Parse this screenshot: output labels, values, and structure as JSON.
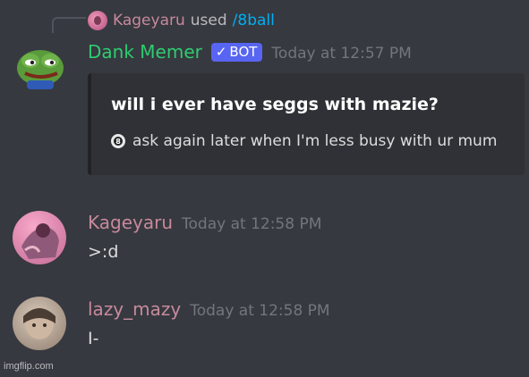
{
  "reply": {
    "username": "Kageyaru",
    "used_text": "used",
    "command": "/8ball"
  },
  "messages": [
    {
      "author": "Dank Memer",
      "badge": "BOT",
      "timestamp": "Today at 12:57 PM",
      "embed": {
        "title": "will i ever have seggs with mazie?",
        "description": "ask again later when I'm less busy with ur mum"
      }
    },
    {
      "author": "Kageyaru",
      "timestamp": "Today at 12:58 PM",
      "content": ">:d"
    },
    {
      "author": "lazy_mazy",
      "timestamp": "Today at 12:58 PM",
      "content": "I-"
    }
  ],
  "watermark": "imgflip.com",
  "colors": {
    "background": "#36393f",
    "embed_bg": "#2f3136",
    "bot_name": "#2ecc71",
    "user_name": "#c7899b",
    "command_link": "#00aff4",
    "bot_badge": "#5865f2"
  }
}
